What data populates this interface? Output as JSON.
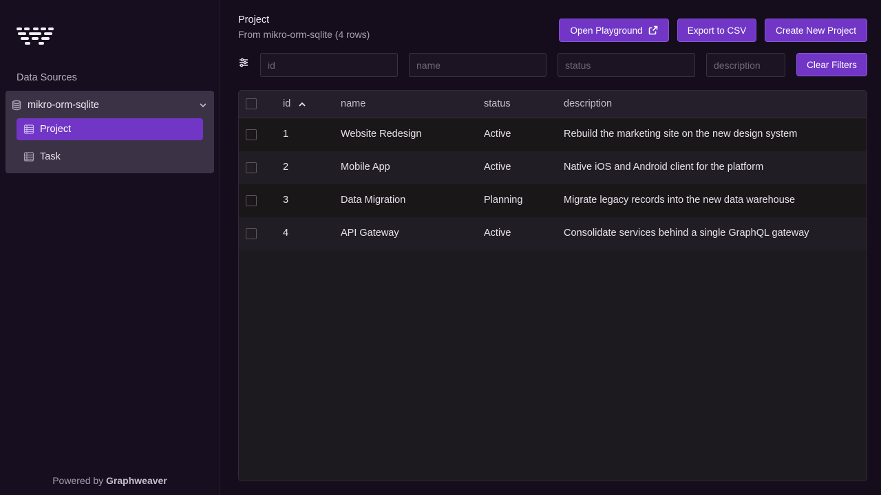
{
  "sidebar": {
    "heading": "Data Sources",
    "data_source": {
      "name": "mikro-orm-sqlite",
      "expanded": true
    },
    "entities": [
      {
        "label": "Project",
        "active": true
      },
      {
        "label": "Task",
        "active": false
      }
    ],
    "footer": {
      "prefix": "Powered by",
      "brand": "Graphweaver"
    }
  },
  "header": {
    "title": "Project",
    "subtitle": "From mikro-orm-sqlite (4 rows)",
    "buttons": {
      "playground": "Open Playground",
      "export": "Export to CSV",
      "create": "Create New Project"
    }
  },
  "filters": {
    "id_placeholder": "id",
    "name_placeholder": "name",
    "status_placeholder": "status",
    "description_placeholder": "description",
    "clear": "Clear Filters"
  },
  "table": {
    "columns": {
      "id": "id",
      "name": "name",
      "status": "status",
      "description": "description"
    },
    "sort": {
      "column": "id",
      "direction": "ascending"
    },
    "rows": [
      {
        "id": "1",
        "name": "Website Redesign",
        "status": "Active",
        "description": "Rebuild the marketing site on the new design system"
      },
      {
        "id": "2",
        "name": "Mobile App",
        "status": "Active",
        "description": "Native iOS and Android client for the platform"
      },
      {
        "id": "3",
        "name": "Data Migration",
        "status": "Planning",
        "description": "Migrate legacy records into the new data warehouse"
      },
      {
        "id": "4",
        "name": "API Gateway",
        "status": "Active",
        "description": "Consolidate services behind a single GraphQL gateway"
      }
    ]
  },
  "colors": {
    "accent": "#7136c6",
    "background": "#150d1c",
    "panel": "#3b3345"
  },
  "icons": [
    "graphweaver-logo",
    "database-icon",
    "chevron-down-icon",
    "table-icon",
    "external-link-icon",
    "filter-sliders-icon",
    "sort-ascending-icon"
  ]
}
